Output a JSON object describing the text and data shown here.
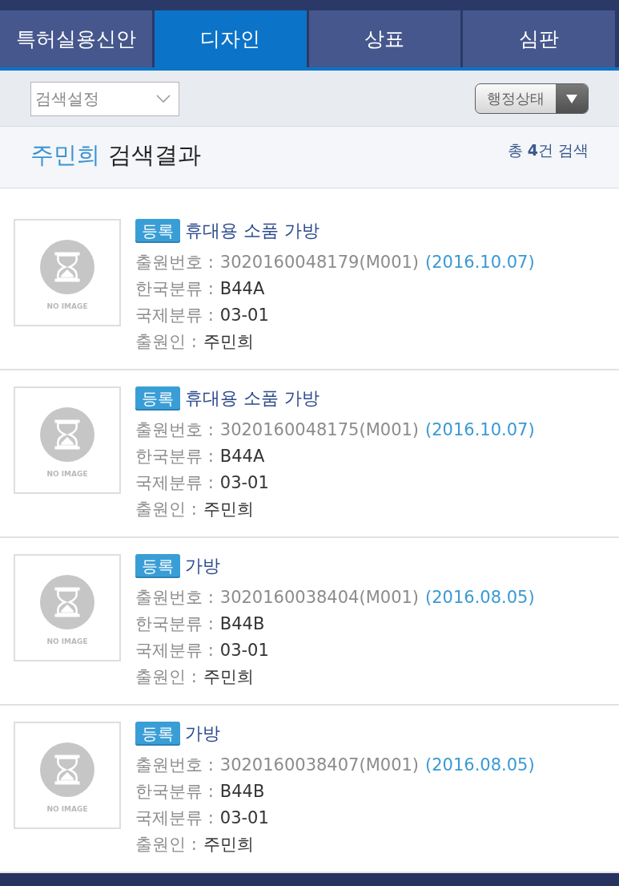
{
  "tabs": [
    {
      "label": "특허실용신안",
      "selected": false
    },
    {
      "label": "디자인",
      "selected": true
    },
    {
      "label": "상표",
      "selected": false
    },
    {
      "label": "심판",
      "selected": false
    }
  ],
  "filter_bar": {
    "search_select": {
      "placeholder": "검색설정"
    },
    "status_dropdown": {
      "label": "행정상태"
    }
  },
  "result_header": {
    "query": "주민희",
    "title": "검색결과",
    "count": "총 **4**건 검색"
  },
  "results": [
    {
      "image_label": "NO IMAGE",
      "badge": "등록",
      "title": "휴대용 소품 가방",
      "fields": [
        {
          "kind": "number",
          "label": "출원번호 :",
          "value": "3020160048179(M001)",
          "date": "(2016.10.07)"
        },
        {
          "kind": "text",
          "label": "한국분류 :",
          "value": "B44A"
        },
        {
          "kind": "text",
          "label": "국제분류 :",
          "value": "03-01"
        },
        {
          "kind": "text",
          "label": "출원인 :",
          "value": "주민희"
        }
      ]
    },
    {
      "image_label": "NO IMAGE",
      "badge": "등록",
      "title": "휴대용 소품 가방",
      "fields": [
        {
          "kind": "number",
          "label": "출원번호 :",
          "value": "3020160048175(M001)",
          "date": "(2016.10.07)"
        },
        {
          "kind": "text",
          "label": "한국분류 :",
          "value": "B44A"
        },
        {
          "kind": "text",
          "label": "국제분류 :",
          "value": "03-01"
        },
        {
          "kind": "text",
          "label": "출원인 :",
          "value": "주민희"
        }
      ]
    },
    {
      "image_label": "NO IMAGE",
      "badge": "등록",
      "title": "가방",
      "fields": [
        {
          "kind": "number",
          "label": "출원번호 :",
          "value": "3020160038404(M001)",
          "date": "(2016.08.05)"
        },
        {
          "kind": "text",
          "label": "한국분류 :",
          "value": "B44B"
        },
        {
          "kind": "text",
          "label": "국제분류 :",
          "value": "03-01"
        },
        {
          "kind": "text",
          "label": "출원인 :",
          "value": "주민희"
        }
      ]
    },
    {
      "image_label": "NO IMAGE",
      "badge": "등록",
      "title": "가방",
      "fields": [
        {
          "kind": "number",
          "label": "출원번호 :",
          "value": "3020160038407(M001)",
          "date": "(2016.08.05)"
        },
        {
          "kind": "text",
          "label": "한국분류 :",
          "value": "B44B"
        },
        {
          "kind": "text",
          "label": "국제분류 :",
          "value": "03-01"
        },
        {
          "kind": "text",
          "label": "출원인 :",
          "value": "주민희"
        }
      ]
    }
  ]
}
